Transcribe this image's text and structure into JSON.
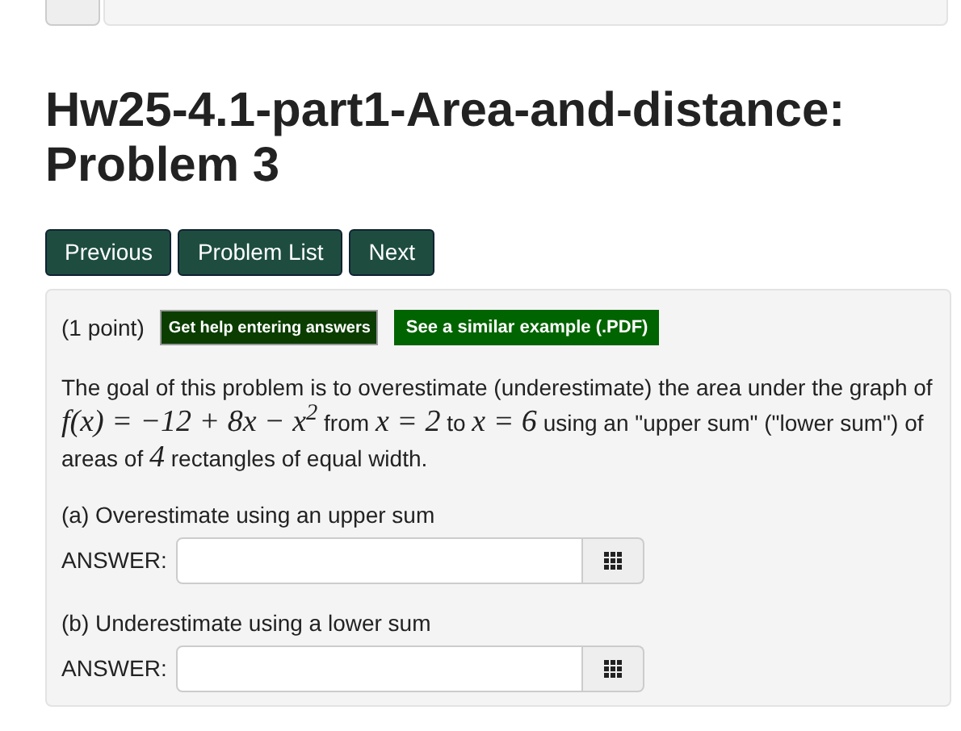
{
  "title": "Hw25-4.1-part1-Area-and-distance: Problem 3",
  "nav_buttons": [
    "Previous",
    "Problem List",
    "Next"
  ],
  "problem": {
    "points": "(1 point)",
    "help_buttons": [
      "Get help entering answers",
      "See a similar example (.PDF)"
    ],
    "statement": [
      {
        "kind": "text",
        "text": "The goal of this problem is to overestimate (underestimate) the area under the graph of "
      },
      {
        "kind": "math",
        "text": "f(x) = −12 + 8x − x$^{2}$"
      },
      {
        "kind": "text",
        "text": " from "
      },
      {
        "kind": "math",
        "text": "x = 2"
      },
      {
        "kind": "text",
        "text": " to "
      },
      {
        "kind": "math",
        "text": "x = 6"
      },
      {
        "kind": "text",
        "text": " using an \"upper sum\" (\"lower sum\") of areas of "
      },
      {
        "kind": "math",
        "text": "4"
      },
      {
        "kind": "text",
        "text": " rectangles of equal width."
      }
    ],
    "parts": [
      {
        "question": "(a) Overestimate using an upper sum",
        "label": "ANSWER:"
      },
      {
        "question": "(b) Underestimate using a lower sum",
        "label": "ANSWER:"
      }
    ]
  }
}
